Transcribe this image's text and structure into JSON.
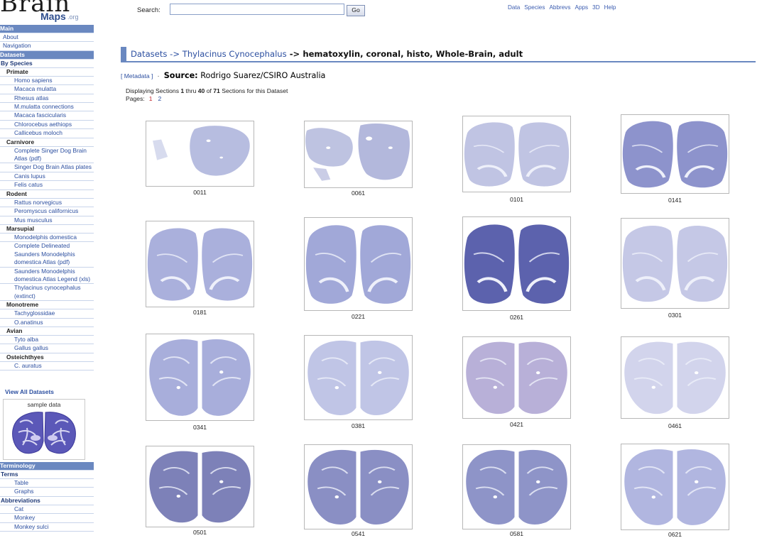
{
  "logo": {
    "brain": "Brain",
    "maps": "Maps",
    "org": ".org"
  },
  "search": {
    "label": "Search:",
    "value": "",
    "go": "Go"
  },
  "topnav": [
    "Data",
    "Species",
    "Abbrevs",
    "Apps",
    "3D",
    "Help"
  ],
  "sidebar": {
    "main_header": "Main",
    "main_items": [
      "About",
      "Navigation"
    ],
    "datasets_header": "Datasets",
    "by_species": "By Species",
    "groups": [
      {
        "name": "Primate",
        "items": [
          "Homo sapiens",
          "Macaca mulatta",
          "Rhesus atlas",
          "M.mulatta connections",
          "Macaca fascicularis",
          "Chlorocebus aethiops",
          "Callicebus moloch"
        ]
      },
      {
        "name": "Carnivore",
        "items": [
          "Complete Singer Dog Brain Atlas (pdf)",
          "Singer Dog Brain Atlas plates",
          "Canis lupus",
          "Felis catus"
        ]
      },
      {
        "name": "Rodent",
        "items": [
          "Rattus norvegicus",
          "Peromyscus californicus",
          "Mus musculus"
        ]
      },
      {
        "name": "Marsupial",
        "items": [
          "Monodelphis domestica",
          "Complete Delineated Saunders Monodelphis domestica Atlas (pdf)",
          "Saunders Monodelphis domestica Atlas Legend (xls)",
          "Thylacinus cynocephalus (extinct)"
        ]
      },
      {
        "name": "Monotreme",
        "items": [
          "Tachyglossidae",
          "O.anatinus"
        ]
      },
      {
        "name": "Avian",
        "items": [
          "Tyto alba",
          "Gallus gallus"
        ]
      },
      {
        "name": "Osteichthyes",
        "items": [
          "C. auratus"
        ]
      }
    ],
    "view_all": "View All Datasets",
    "sample_label": "sample data",
    "terminology_header": "Terminology",
    "terms_sub": "Terms",
    "terms_items": [
      "Table",
      "Graphs"
    ],
    "abbrev_sub": "Abbreviations",
    "abbrev_items": [
      "Cat",
      "Monkey",
      "Monkey sulci"
    ]
  },
  "breadcrumb": {
    "datasets": "Datasets",
    "sep1": " -> ",
    "species": "Thylacinus Cynocephalus",
    "sep2": " -> ",
    "current": "hematoxylin, coronal, histo, Whole-Brain, adult"
  },
  "meta": {
    "link": "[ Metadata ]",
    "dot": "·",
    "source_label": "Source:",
    "source_value": "Rodrigo Suarez/CSIRO Australia"
  },
  "display": {
    "prefix": "Displaying Sections ",
    "from": "1",
    "mid": " thru ",
    "to": "40",
    "of": " of ",
    "total": "71",
    "suffix": " Sections for this Dataset"
  },
  "pages": {
    "label": "Pages:",
    "p1": "1",
    "p2": "2"
  },
  "sections": [
    {
      "label": "0011",
      "shade": "#b7bde0",
      "style": "split"
    },
    {
      "label": "0061",
      "shade": "#b3b8dc",
      "style": "frag"
    },
    {
      "label": "0101",
      "shade": "#c0c4e3",
      "style": "full"
    },
    {
      "label": "0141",
      "shade": "#8d93cc",
      "style": "full"
    },
    {
      "label": "0181",
      "shade": "#aab0dc",
      "style": "full"
    },
    {
      "label": "0221",
      "shade": "#a1a8d8",
      "style": "full"
    },
    {
      "label": "0261",
      "shade": "#5c62ad",
      "style": "full"
    },
    {
      "label": "0301",
      "shade": "#c5c8e6",
      "style": "full"
    },
    {
      "label": "0341",
      "shade": "#a8aedb",
      "style": "round"
    },
    {
      "label": "0381",
      "shade": "#c0c5e6",
      "style": "round"
    },
    {
      "label": "0421",
      "shade": "#b8b0d8",
      "style": "round"
    },
    {
      "label": "0461",
      "shade": "#d2d4ec",
      "style": "round"
    },
    {
      "label": "0501",
      "shade": "#7d81b8",
      "style": "round"
    },
    {
      "label": "0541",
      "shade": "#8a8fc4",
      "style": "round"
    },
    {
      "label": "0581",
      "shade": "#8e94c8",
      "style": "round"
    },
    {
      "label": "0621",
      "shade": "#b1b6e0",
      "style": "round"
    }
  ]
}
